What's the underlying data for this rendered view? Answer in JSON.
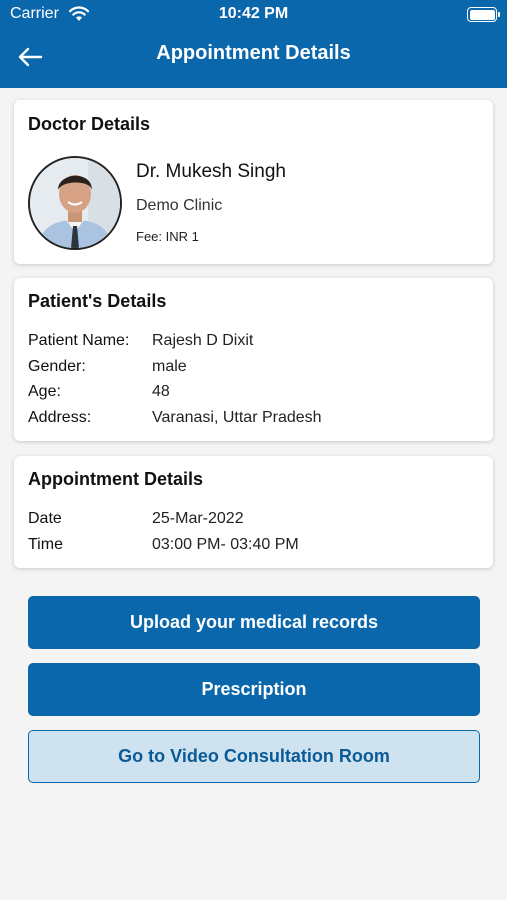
{
  "status_bar": {
    "carrier": "Carrier",
    "time": "10:42 PM"
  },
  "header": {
    "title": "Appointment Details"
  },
  "doctor_card": {
    "title": "Doctor Details",
    "name": "Dr. Mukesh Singh",
    "clinic": "Demo Clinic",
    "fee": "Fee: INR 1"
  },
  "patient_card": {
    "title": "Patient's Details",
    "rows": [
      {
        "label": "Patient Name:",
        "value": "Rajesh D Dixit"
      },
      {
        "label": "Gender:",
        "value": "male"
      },
      {
        "label": "Age:",
        "value": "48"
      },
      {
        "label": "Address:",
        "value": "Varanasi, Uttar Pradesh"
      }
    ]
  },
  "appointment_card": {
    "title": "Appointment Details",
    "rows": [
      {
        "label": "Date",
        "value": "25-Mar-2022"
      },
      {
        "label": "Time",
        "value": "03:00 PM- 03:40 PM"
      }
    ]
  },
  "actions": {
    "upload_label": "Upload your medical records",
    "prescription_label": "Prescription",
    "video_label": "Go to Video Consultation Room"
  },
  "colors": {
    "brand": "#0a67ab",
    "secondary_button_bg": "#cfe2ef",
    "page_bg": "#f4f4f4"
  },
  "icons": {
    "back": "arrow-left-icon",
    "wifi": "wifi-icon",
    "battery": "battery-icon",
    "avatar": "doctor-photo"
  }
}
